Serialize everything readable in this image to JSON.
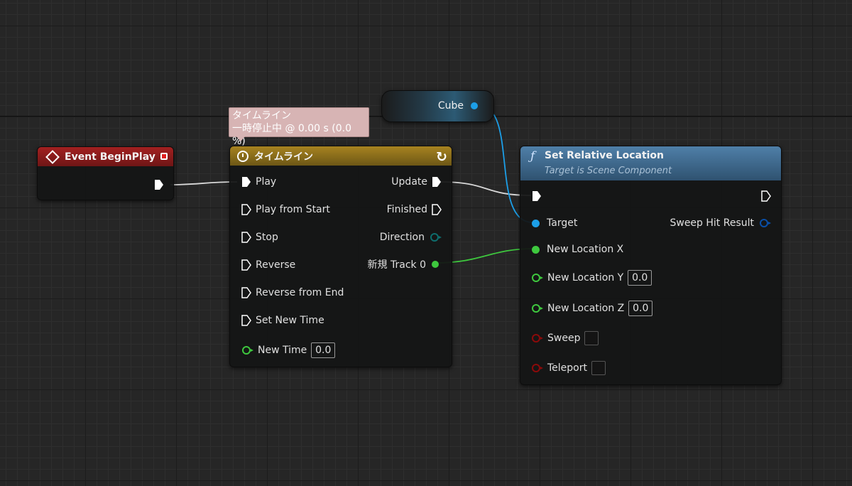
{
  "tooltip": {
    "line1": "タイムライン",
    "line2": "一時停止中 @ 0.00 s (0.0 %)"
  },
  "event_node": {
    "title": "Event BeginPlay"
  },
  "timeline_node": {
    "title": "タイムライン",
    "inputs": [
      "Play",
      "Play from Start",
      "Stop",
      "Reverse",
      "Reverse from End",
      "Set New Time"
    ],
    "new_time_label": "New Time",
    "new_time_value": "0.0",
    "outputs": [
      "Update",
      "Finished",
      "Direction",
      "新規 Track 0"
    ]
  },
  "cube_node": {
    "label": "Cube"
  },
  "set_node": {
    "title": "Set Relative Location",
    "subtitle": "Target is Scene Component",
    "target": "Target",
    "sweep_hit": "Sweep Hit Result",
    "loc_x": "New Location X",
    "loc_y": "New Location Y",
    "loc_y_value": "0.0",
    "loc_z": "New Location Z",
    "loc_z_value": "0.0",
    "sweep": "Sweep",
    "teleport": "Teleport"
  },
  "colors": {
    "event_header": "#8b1a1a",
    "timeline_header": "#9a7a1c",
    "set_header": "#3e6a90",
    "object_pin": "#1c9fe8",
    "float_pin": "#3ec83e",
    "bool_pin": "#8c0a0a"
  }
}
